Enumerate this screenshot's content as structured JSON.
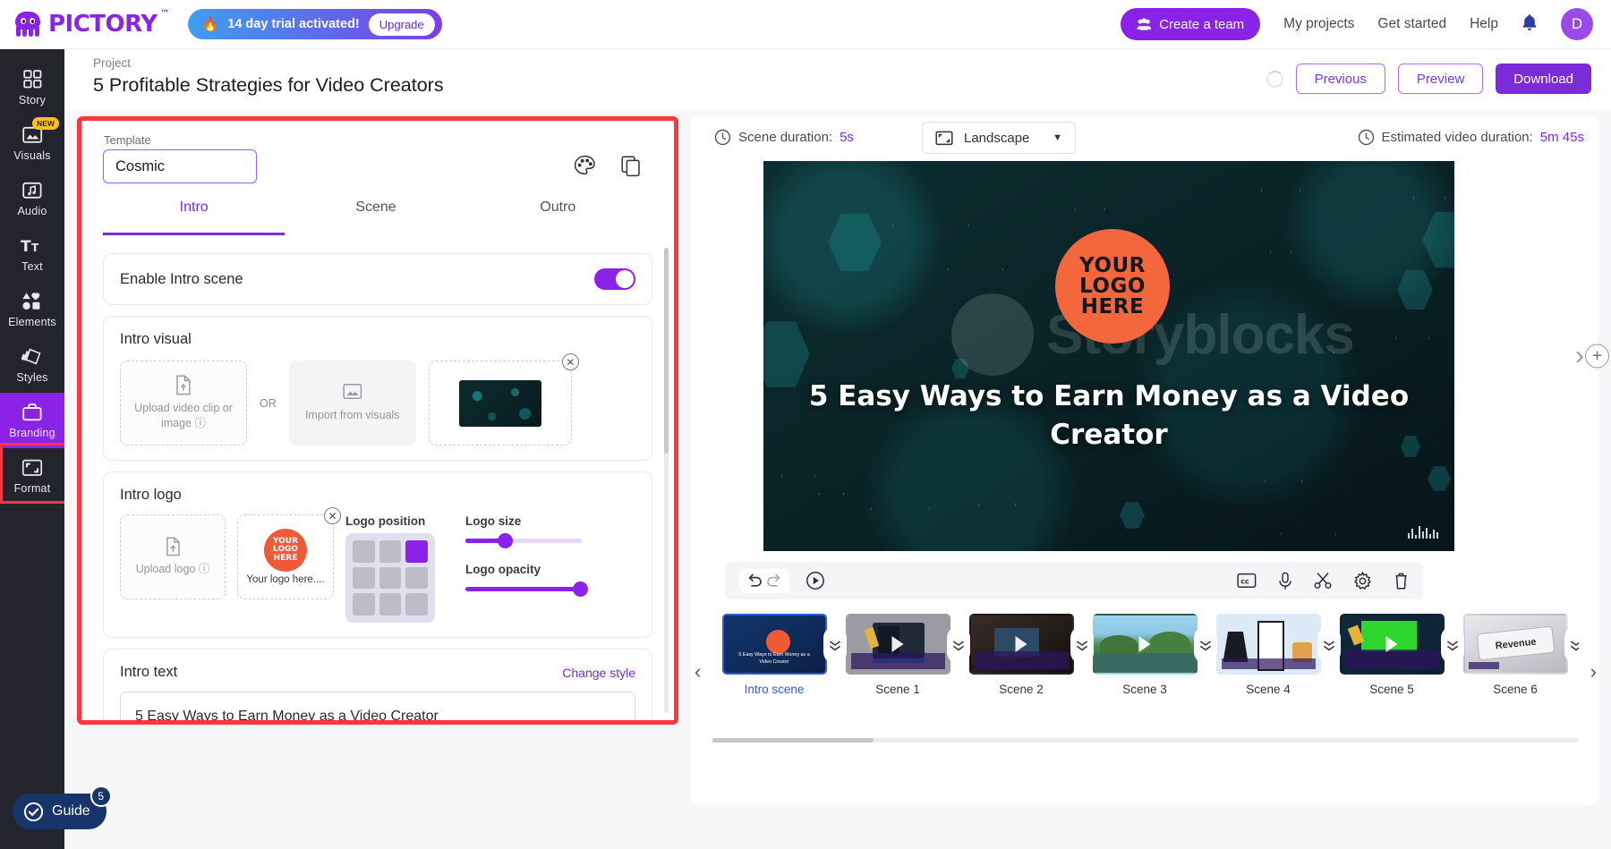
{
  "topbar": {
    "brand_name": "PICTORY",
    "brand_tm": "™",
    "trial_text": "14 day trial activated!",
    "upgrade_label": "Upgrade",
    "create_team_label": "Create a team",
    "my_projects_label": "My projects",
    "get_started_label": "Get started",
    "help_label": "Help",
    "avatar_initial": "D",
    "accent": "#8b22e8"
  },
  "sidebar": {
    "items": [
      {
        "label": "Story",
        "icon": "grid-icon",
        "badge": ""
      },
      {
        "label": "Visuals",
        "icon": "image-icon",
        "badge": "NEW"
      },
      {
        "label": "Audio",
        "icon": "music-icon",
        "badge": ""
      },
      {
        "label": "Text",
        "icon": "text-icon",
        "badge": ""
      },
      {
        "label": "Elements",
        "icon": "shapes-icon",
        "badge": ""
      },
      {
        "label": "Styles",
        "icon": "styles-icon",
        "badge": ""
      },
      {
        "label": "Branding",
        "icon": "briefcase-icon",
        "badge": ""
      },
      {
        "label": "Format",
        "icon": "crop-icon",
        "badge": ""
      }
    ],
    "active_index": 6,
    "highlight_color": "#fb3640"
  },
  "guide": {
    "label": "Guide",
    "count": "5"
  },
  "project": {
    "label": "Project",
    "title": "5 Profitable Strategies for Video Creators",
    "previous_label": "Previous",
    "preview_label": "Preview",
    "download_label": "Download"
  },
  "editor": {
    "template_label": "Template",
    "template_value": "Cosmic",
    "palette_icon": "palette-icon",
    "copy_icon": "copy-icon",
    "tabs": [
      {
        "label": "Intro",
        "active": true
      },
      {
        "label": "Scene",
        "active": false
      },
      {
        "label": "Outro",
        "active": false
      }
    ],
    "enable_intro_label": "Enable Intro scene",
    "enable_intro_on": true,
    "intro_visual": {
      "title": "Intro visual",
      "upload_label": "Upload video clip or image",
      "or_label": "OR",
      "import_label": "Import from visuals",
      "selected_thumb_name": "cosmic-visual-thumbnail"
    },
    "intro_logo": {
      "title": "Intro logo",
      "upload_label": "Upload logo",
      "logo_caption": "Your logo here....",
      "logo_text_lines": [
        "YOUR",
        "LOGO",
        "HERE"
      ],
      "logo_color": "#f05a37",
      "position_label": "Logo position",
      "position_selected_cell": 2,
      "size_label": "Logo size",
      "size_percent": 35,
      "opacity_label": "Logo opacity",
      "opacity_percent": 100
    },
    "intro_text": {
      "title": "Intro text",
      "change_style_label": "Change style",
      "value": "5 Easy Ways to Earn Money as a Video Creator"
    }
  },
  "preview": {
    "scene_duration_label": "Scene duration:",
    "scene_duration_value": "5s",
    "aspect_ratio_value": "Landscape",
    "estimated_label": "Estimated video duration:",
    "estimated_value": "5m 45s",
    "video": {
      "title": "5 Easy Ways to Earn Money as a Video Creator",
      "logo_lines": [
        "YOUR",
        "LOGO",
        "HERE"
      ],
      "watermark_text": "Storyblocks"
    },
    "toolbar": {
      "undo_icon": "undo-icon",
      "redo_icon": "redo-icon",
      "play_icon": "play-icon",
      "caption_icon": "closed-caption-icon",
      "mic_icon": "microphone-icon",
      "scissors_icon": "scissors-icon",
      "settings_icon": "gear-icon",
      "delete_icon": "trash-icon"
    },
    "scenes": [
      {
        "label": "Intro scene",
        "selected": true,
        "overlay": "5 Easy Ways to Earn Money as a Video Creator"
      },
      {
        "label": "Scene 1",
        "selected": false,
        "overlay": ""
      },
      {
        "label": "Scene 2",
        "selected": false,
        "overlay": ""
      },
      {
        "label": "Scene 3",
        "selected": false,
        "overlay": ""
      },
      {
        "label": "Scene 4",
        "selected": false,
        "overlay": ""
      },
      {
        "label": "Scene 5",
        "selected": false,
        "overlay": ""
      },
      {
        "label": "Scene 6",
        "selected": false,
        "overlay": "Revenue"
      }
    ]
  }
}
